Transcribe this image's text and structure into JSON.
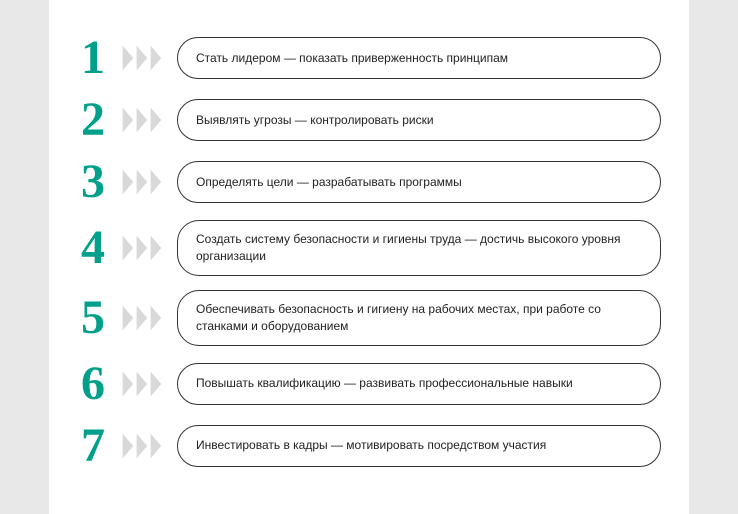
{
  "items": [
    {
      "n": "1",
      "text": "Стать лидером — показать приверженность принципам"
    },
    {
      "n": "2",
      "text": "Выявлять угрозы — контролировать риски"
    },
    {
      "n": "3",
      "text": "Определять цели — разрабатывать программы"
    },
    {
      "n": "4",
      "text": "Создать систему безопасности и гигиены труда — достичь высокого уровня организации"
    },
    {
      "n": "5",
      "text": "Обеспечивать безопасность и гигиену на рабочих местах, при работе со станками и оборудованием"
    },
    {
      "n": "6",
      "text": "Повышать квалификацию — развивать профессиональные навыки"
    },
    {
      "n": "7",
      "text": "Инвестировать в кадры — мотивировать посредством участия"
    }
  ],
  "colors": {
    "accent": "#00a08a",
    "arrowFill": "#d9d9d9",
    "arrowStroke": "#ffffff"
  }
}
